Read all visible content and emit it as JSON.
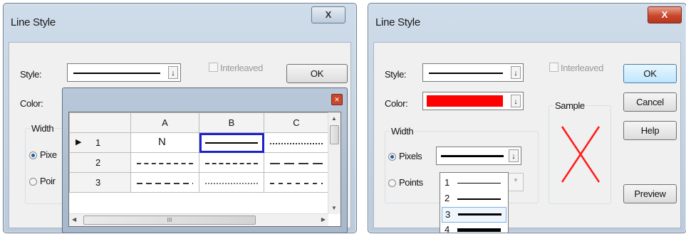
{
  "left_dialog": {
    "title": "Line Style",
    "close_glyph": "X",
    "style_label": "Style:",
    "color_label": "Color:",
    "interleaved_label": "Interleaved",
    "ok_label": "OK",
    "width_group_label": "Width",
    "pixels_label": "Pixe",
    "points_label": "Poir",
    "popup": {
      "columns": [
        "A",
        "B",
        "C"
      ],
      "rows": [
        {
          "num": "1",
          "cells": [
            "N",
            "solid",
            "dotted"
          ],
          "current": true
        },
        {
          "num": "2",
          "cells": [
            "dashdot",
            "dash",
            "longdash"
          ]
        },
        {
          "num": "3",
          "cells": [
            "dash2",
            "dots",
            "dashdot2"
          ]
        }
      ],
      "selected_cell": "B1",
      "scroll_grip": "III"
    }
  },
  "right_dialog": {
    "title": "Line Style",
    "close_glyph": "X",
    "style_label": "Style:",
    "color_label": "Color:",
    "color_value": "#ff0000",
    "interleaved_label": "Interleaved",
    "ok_label": "OK",
    "cancel_label": "Cancel",
    "help_label": "Help",
    "preview_label": "Preview",
    "sample_label": "Sample",
    "width_group_label": "Width",
    "pixels_label": "Pixels",
    "points_label": "Points",
    "width_options": [
      "1",
      "2",
      "3",
      "4"
    ],
    "selected_width": "3"
  },
  "icons": {
    "dropdown_arrow": "dropdown-arrow-icon",
    "close": "close-icon",
    "row_pointer": "row-pointer-icon"
  }
}
